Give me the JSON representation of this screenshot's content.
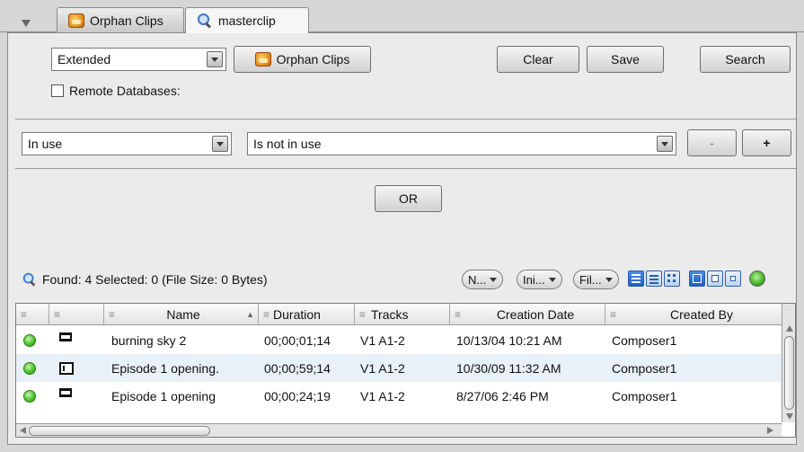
{
  "tabs": [
    {
      "label": "Orphan Clips",
      "icon": "orphan-clips-icon"
    },
    {
      "label": "masterclip",
      "icon": "search-icon"
    }
  ],
  "search_panel": {
    "mode_value": "Extended",
    "orphan_button_label": "Orphan Clips",
    "clear_label": "Clear",
    "save_label": "Save",
    "search_label": "Search",
    "remote_label": "Remote Databases:"
  },
  "criteria": {
    "field_value": "In use",
    "condition_value": "Is not in use",
    "minus_label": "-",
    "plus_label": "+",
    "or_label": "OR"
  },
  "status": {
    "text": "Found: 4 Selected: 0 (File Size: 0 Bytes)"
  },
  "filters": [
    "N...",
    "Ini...",
    "Fil..."
  ],
  "table": {
    "columns": [
      "Name",
      "Duration",
      "Tracks",
      "Creation Date",
      "Created By"
    ],
    "rows": [
      {
        "name": "burning sky 2",
        "duration": "00;00;01;14",
        "tracks": "V1 A1-2",
        "date": "10/13/04 10:21 AM",
        "by": "Composer1",
        "type": "masterclip"
      },
      {
        "name": "Episode 1 opening.",
        "duration": "00;00;59;14",
        "tracks": "V1 A1-2",
        "date": "10/30/09 11:32 AM",
        "by": "Composer1",
        "type": "sequence"
      },
      {
        "name": "Episode 1 opening",
        "duration": "00;00;24;19",
        "tracks": "V1 A1-2",
        "date": "8/27/06 2:46 PM",
        "by": "Composer1",
        "type": "masterclip"
      }
    ]
  },
  "colors": {
    "status_green": "#4fc22d",
    "selected_view_blue": "#1f5fc6",
    "row_alt": "#e8f0f8"
  }
}
